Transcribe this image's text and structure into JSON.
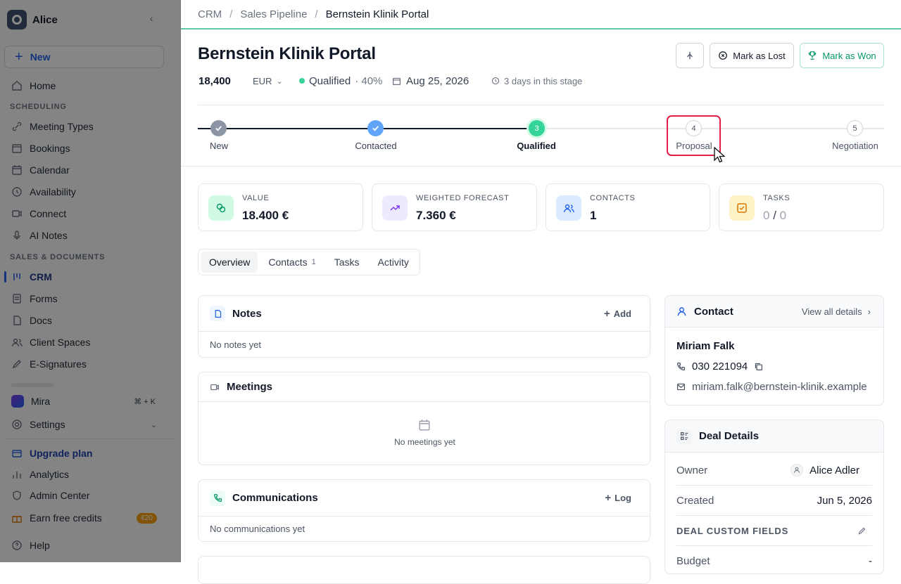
{
  "sidebar": {
    "workspace": "Alice",
    "new_label": "New",
    "items": {
      "home": "Home",
      "section_scheduling": "SCHEDULING",
      "meeting_types": "Meeting Types",
      "bookings": "Bookings",
      "calendar": "Calendar",
      "availability": "Availability",
      "connect": "Connect",
      "ai_notes": "AI Notes",
      "section_sales": "SALES & DOCUMENTS",
      "crm": "CRM",
      "forms": "Forms",
      "docs": "Docs",
      "client_spaces": "Client Spaces",
      "esignatures": "E-Signatures",
      "mira": "Mira",
      "mira_shortcut": "⌘ + K",
      "settings": "Settings",
      "upgrade": "Upgrade plan",
      "analytics": "Analytics",
      "admin_center": "Admin Center",
      "earn_credits": "Earn free credits",
      "credit_badge": "€20",
      "help": "Help"
    }
  },
  "breadcrumb": {
    "root": "CRM",
    "pipeline": "Sales Pipeline",
    "current": "Bernstein Klinik Portal"
  },
  "deal": {
    "title": "Bernstein Klinik Portal",
    "amount": "18,400",
    "currency": "EUR",
    "stage_label": "Qualified",
    "stage_prob": "· 40%",
    "close_date": "Aug 25, 2026",
    "time_in_stage": "3 days in this stage",
    "mark_lost": "Mark as Lost",
    "mark_won": "Mark as Won"
  },
  "stepper": [
    {
      "num": "",
      "label": "New",
      "state": "done"
    },
    {
      "num": "",
      "label": "Contacted",
      "state": "done"
    },
    {
      "num": "3",
      "label": "Qualified",
      "state": "current"
    },
    {
      "num": "4",
      "label": "Proposal",
      "state": "todo"
    },
    {
      "num": "5",
      "label": "Negotiation",
      "state": "todo"
    }
  ],
  "stats": {
    "value_label": "VALUE",
    "value": "18.400 €",
    "forecast_label": "WEIGHTED FORECAST",
    "forecast": "7.360 €",
    "contacts_label": "CONTACTS",
    "contacts": "1",
    "tasks_label": "TASKS",
    "tasks_done": "0",
    "tasks_sep": " / ",
    "tasks_total": "0"
  },
  "tabs": {
    "overview": "Overview",
    "contacts": "Contacts",
    "contacts_count": "1",
    "tasks": "Tasks",
    "activity": "Activity"
  },
  "notes": {
    "title": "Notes",
    "action": "Add",
    "empty": "No notes yet"
  },
  "meetings": {
    "title": "Meetings",
    "empty": "No meetings yet"
  },
  "communications": {
    "title": "Communications",
    "action": "Log",
    "empty": "No communications yet"
  },
  "contact": {
    "title": "Contact",
    "view_all": "View all details",
    "name": "Miriam Falk",
    "phone": "030 221094",
    "email": "miriam.falk@bernstein-klinik.example"
  },
  "deal_details": {
    "title": "Deal Details",
    "owner_label": "Owner",
    "owner": "Alice Adler",
    "created_label": "Created",
    "created": "Jun 5, 2026",
    "custom_fields": "DEAL CUSTOM FIELDS",
    "budget_label": "Budget",
    "budget": "-"
  }
}
